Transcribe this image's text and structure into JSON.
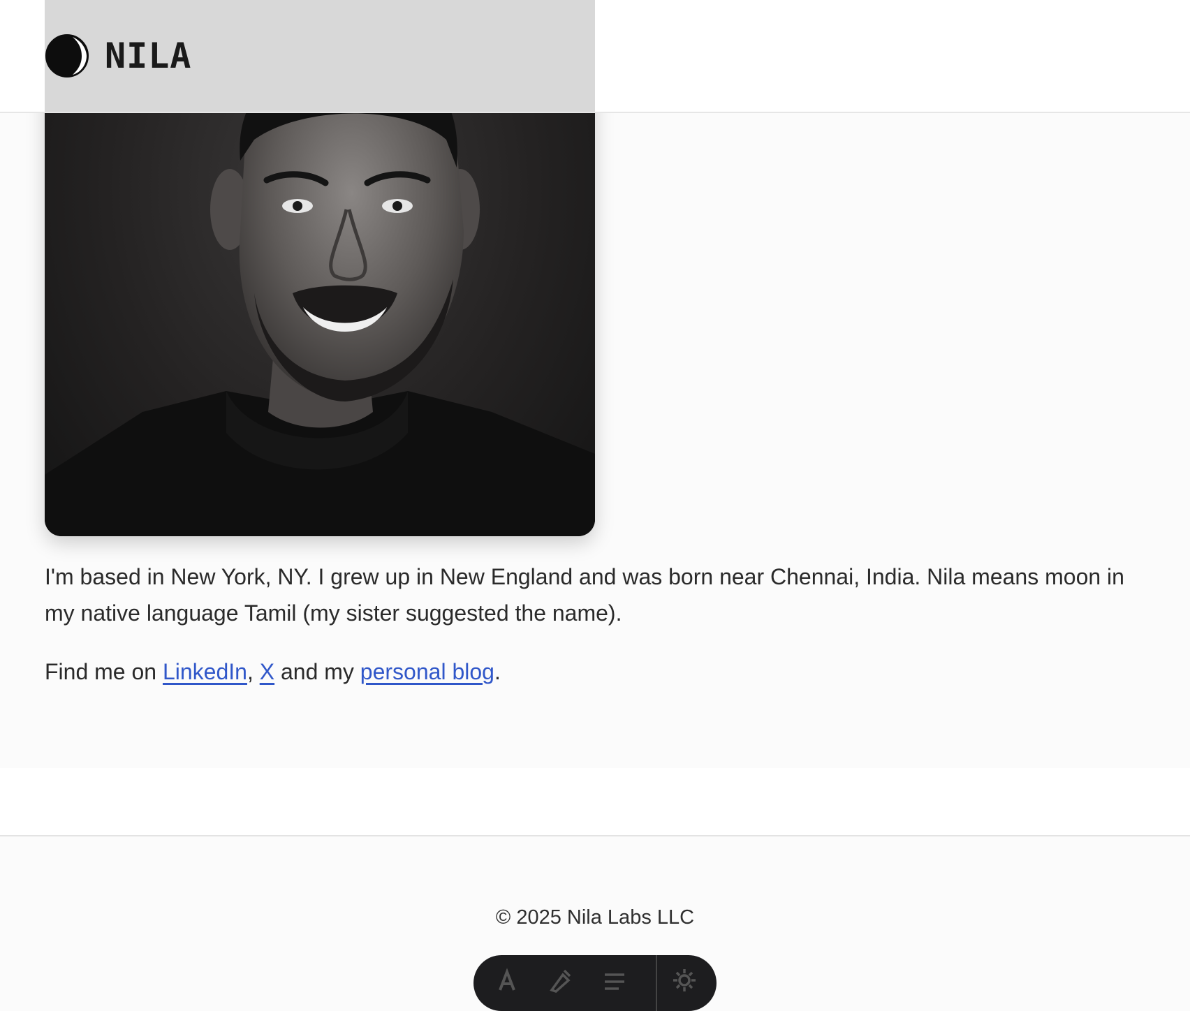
{
  "header": {
    "logo_text": "NILA",
    "logo_icon": "crescent-moon-icon",
    "image_alt": "Black and white portrait of a smiling man with a beard"
  },
  "about": {
    "paragraph1": "I'm based in New York, NY. I grew up in New England and was born near Chennai, India. Nila means moon in my native language Tamil (my sister suggested the name).",
    "find_prefix": "Find me on ",
    "linkedin_label": "LinkedIn",
    "sep_comma": ", ",
    "x_label": "X",
    "and_my": " and my ",
    "blog_label": "personal blog",
    "period": "."
  },
  "footer": {
    "copyright": "© 2025 Nila Labs LLC"
  },
  "toolbar": {
    "icons": [
      "font-icon",
      "highlighter-icon",
      "lines-icon",
      "gear-icon"
    ]
  },
  "colors": {
    "link": "#3057c9",
    "toolbar_bg": "#1d1d1f",
    "page_bg": "#fbfbfb"
  }
}
